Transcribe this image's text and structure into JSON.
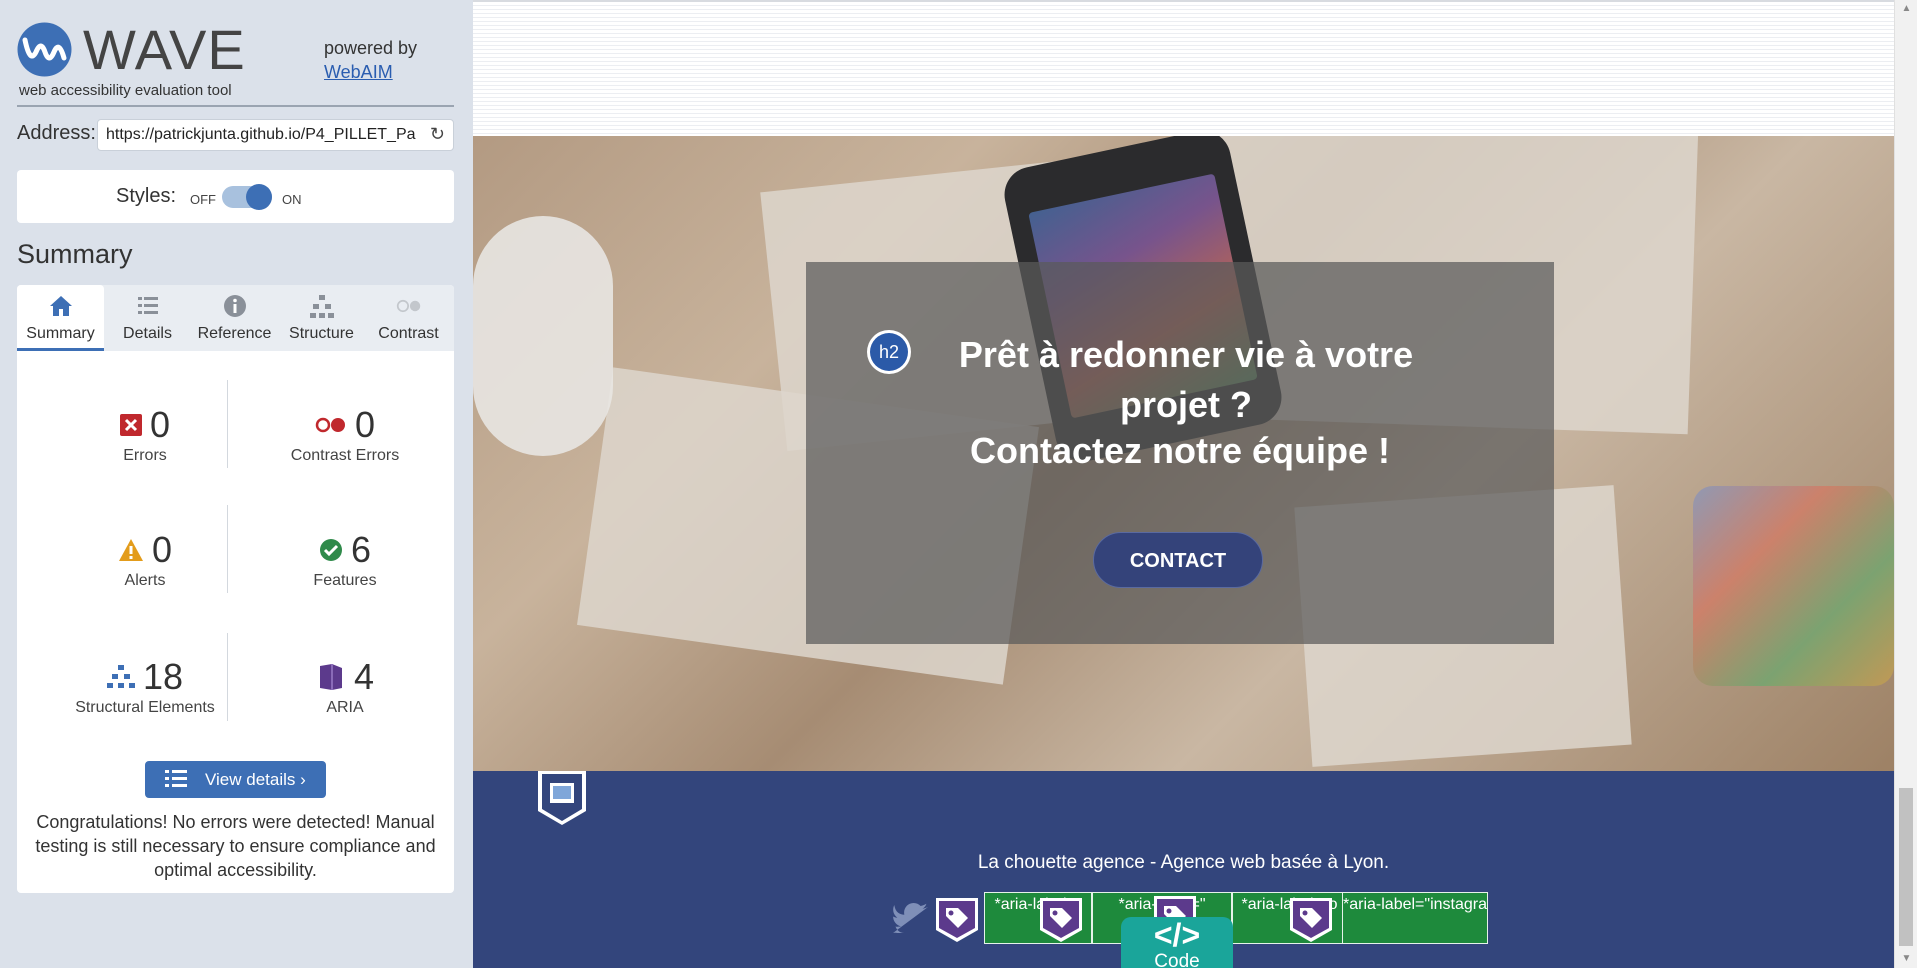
{
  "wave": {
    "logo_text": "WAVE",
    "logo_subtitle": "web accessibility evaluation tool",
    "powered_by": "powered by",
    "webaim_link": "WebAIM",
    "address_label": "Address:",
    "address_value": "https://patrickjunta.github.io/P4_PILLET_Pa",
    "styles_label": "Styles:",
    "styles_off": "OFF",
    "styles_on": "ON",
    "styles_enabled": true,
    "summary_heading": "Summary",
    "tabs": [
      {
        "label": "Summary",
        "icon": "home-icon",
        "active": true
      },
      {
        "label": "Details",
        "icon": "list-icon",
        "active": false
      },
      {
        "label": "Reference",
        "icon": "info-icon",
        "active": false
      },
      {
        "label": "Structure",
        "icon": "hierarchy-icon",
        "active": false
      },
      {
        "label": "Contrast",
        "icon": "contrast-icon",
        "active": false
      }
    ],
    "stats": {
      "errors": {
        "value": "0",
        "label": "Errors",
        "color": "#c0282d"
      },
      "contrast_errors": {
        "value": "0",
        "label": "Contrast Errors",
        "color": "#c0282d"
      },
      "alerts": {
        "value": "0",
        "label": "Alerts",
        "color": "#e39c1b"
      },
      "features": {
        "value": "6",
        "label": "Features",
        "color": "#2f8a4a"
      },
      "structural": {
        "value": "18",
        "label": "Structural Elements",
        "color": "#3d6fb5"
      },
      "aria": {
        "value": "4",
        "label": "ARIA",
        "color": "#5c3a8c"
      }
    },
    "view_details": "View details ›",
    "congrats": "Congratulations! No errors were detected! Manual testing is still necessary to ensure compliance and optimal accessibility."
  },
  "page": {
    "h2_badge": "h2",
    "hero_title": "Prêt à redonner vie à votre projet ?",
    "hero_subtitle": "Contactez notre équipe !",
    "contact_button": "CONTACT",
    "footer_text": "La chouette agence - Agence web basée à Lyon.",
    "aria_labels": [
      {
        "text": "*aria-label=\""
      },
      {
        "text": "*aria-label=\""
      },
      {
        "text": "*aria-label=\"o"
      },
      {
        "text": "*aria-label=\"instagram\"*"
      }
    ],
    "code_tab": "Code"
  },
  "colors": {
    "sidebar_bg": "#dbe1ea",
    "wave_blue": "#3d6fb5",
    "footer_bg": "#33457c",
    "aria_green": "#1e8a3c",
    "code_teal": "#1aa59a"
  }
}
